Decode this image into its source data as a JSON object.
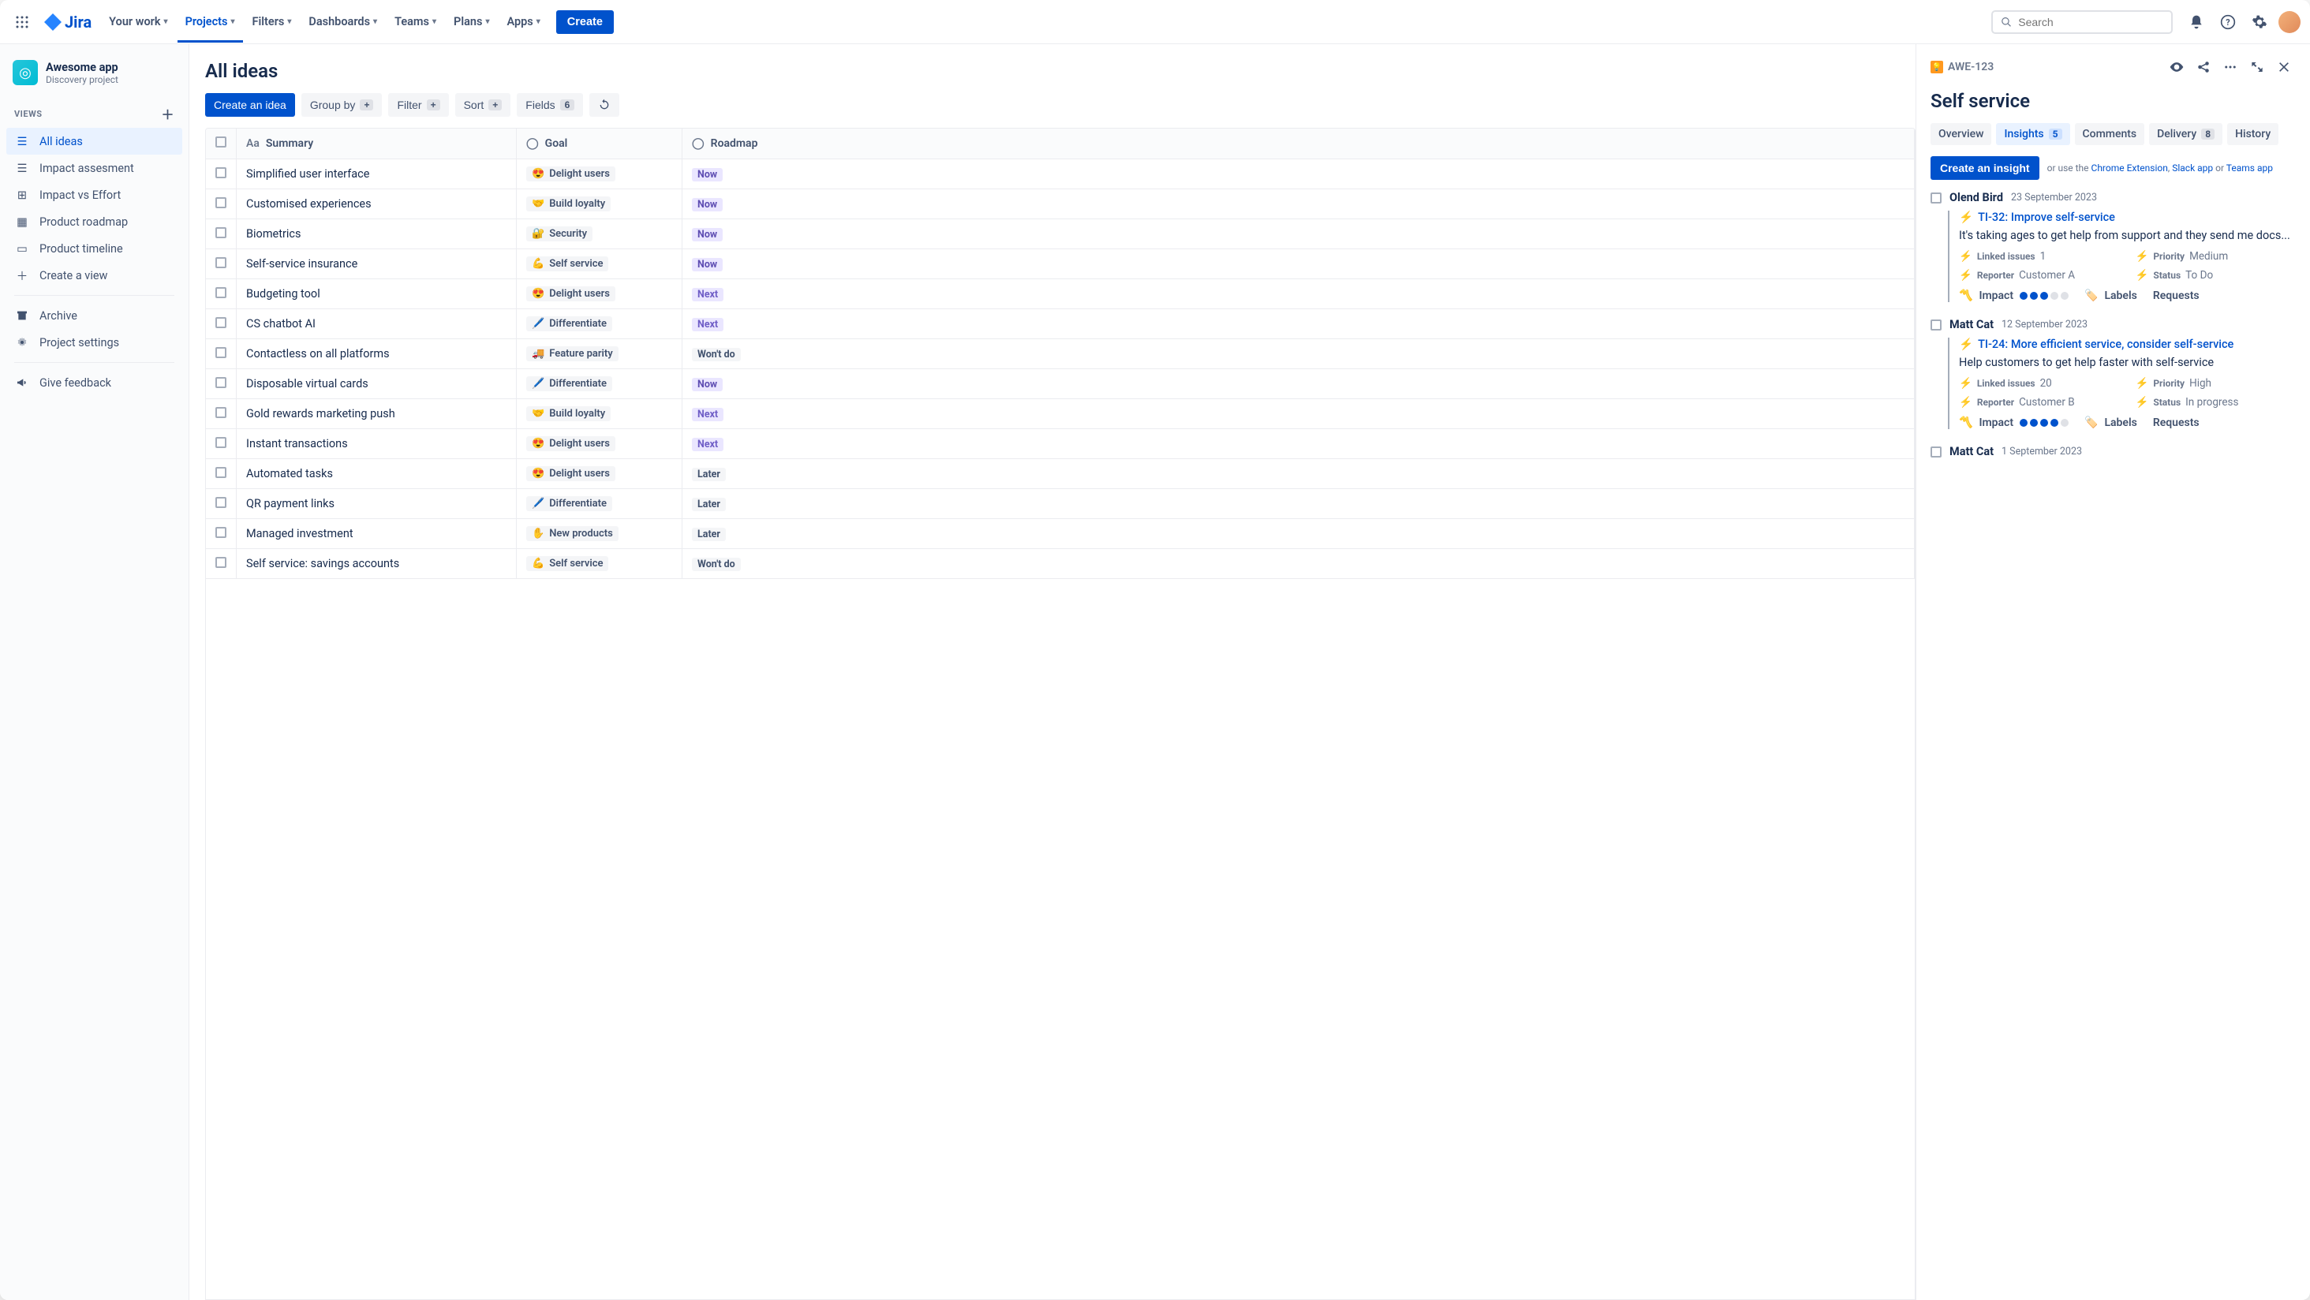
{
  "topnav": {
    "logo": "Jira",
    "items": [
      "Your work",
      "Projects",
      "Filters",
      "Dashboards",
      "Teams",
      "Plans",
      "Apps"
    ],
    "active_index": 1,
    "create": "Create",
    "search_placeholder": "Search"
  },
  "sidebar": {
    "project": {
      "name": "Awesome app",
      "type": "Discovery project"
    },
    "views_label": "Views",
    "views": [
      "All ideas",
      "Impact assesment",
      "Impact vs Effort",
      "Product roadmap",
      "Product timeline",
      "Create a view"
    ],
    "selected_view": 0,
    "archive": "Archive",
    "settings": "Project settings",
    "feedback": "Give feedback"
  },
  "page": {
    "title": "All ideas",
    "toolbar": {
      "create": "Create an idea",
      "group": "Group by",
      "filter": "Filter",
      "sort": "Sort",
      "fields": "Fields",
      "fields_count": "6"
    },
    "columns": [
      "Summary",
      "Goal",
      "Roadmap"
    ],
    "goals": {
      "delight": {
        "emoji": "😍",
        "label": "Delight users"
      },
      "loyalty": {
        "emoji": "🤝",
        "label": "Build loyalty"
      },
      "security": {
        "emoji": "🔐",
        "label": "Security"
      },
      "selfservice": {
        "emoji": "💪",
        "label": "Self service"
      },
      "differentiate": {
        "emoji": "🖊️",
        "label": "Differentiate"
      },
      "parity": {
        "emoji": "🚚",
        "label": "Feature parity"
      },
      "newproducts": {
        "emoji": "✋",
        "label": "New products"
      }
    },
    "rows": [
      {
        "summary": "Simplified user interface",
        "goal": "delight",
        "roadmap": "Now"
      },
      {
        "summary": "Customised experiences",
        "goal": "loyalty",
        "roadmap": "Now"
      },
      {
        "summary": "Biometrics",
        "goal": "security",
        "roadmap": "Now"
      },
      {
        "summary": "Self-service insurance",
        "goal": "selfservice",
        "roadmap": "Now"
      },
      {
        "summary": "Budgeting tool",
        "goal": "delight",
        "roadmap": "Next"
      },
      {
        "summary": "CS chatbot AI",
        "goal": "differentiate",
        "roadmap": "Next"
      },
      {
        "summary": "Contactless on all platforms",
        "goal": "parity",
        "roadmap": "Won't do"
      },
      {
        "summary": "Disposable virtual cards",
        "goal": "differentiate",
        "roadmap": "Now"
      },
      {
        "summary": "Gold rewards marketing push",
        "goal": "loyalty",
        "roadmap": "Next"
      },
      {
        "summary": "Instant transactions",
        "goal": "delight",
        "roadmap": "Next"
      },
      {
        "summary": "Automated tasks",
        "goal": "delight",
        "roadmap": "Later"
      },
      {
        "summary": "QR payment links",
        "goal": "differentiate",
        "roadmap": "Later"
      },
      {
        "summary": "Managed investment",
        "goal": "newproducts",
        "roadmap": "Later"
      },
      {
        "summary": "Self service: savings accounts",
        "goal": "selfservice",
        "roadmap": "Won't do"
      }
    ]
  },
  "detail": {
    "key": "AWE-123",
    "title": "Self service",
    "tabs": [
      {
        "label": "Overview"
      },
      {
        "label": "Insights",
        "count": "5",
        "active": true
      },
      {
        "label": "Comments"
      },
      {
        "label": "Delivery",
        "count": "8"
      },
      {
        "label": "History"
      }
    ],
    "create_insight": "Create an insight",
    "helper_prefix": "or use the ",
    "helper_links": [
      "Chrome Extension",
      "Slack app",
      "Teams app"
    ],
    "insights": [
      {
        "author": "Olend Bird",
        "date": "23 September 2023",
        "link": "TI-32: Improve self-service",
        "text": "It's taking ages to get help from support and they send me docs...",
        "linked_issues": "1",
        "priority": "Medium",
        "reporter": "Customer A",
        "status": "To Do",
        "impact": 3,
        "labels": "Labels",
        "requests": "Requests"
      },
      {
        "author": "Matt Cat",
        "date": "12 September 2023",
        "link": "TI-24: More efficient service, consider self-service",
        "text": "Help customers to get help faster with self-service",
        "linked_issues": "20",
        "priority": "High",
        "reporter": "Customer B",
        "status": "In progress",
        "impact": 4,
        "labels": "Labels",
        "requests": "Requests"
      },
      {
        "author": "Matt Cat",
        "date": "1 September 2023"
      }
    ],
    "meta_labels": {
      "linked": "Linked issues",
      "priority": "Priority",
      "reporter": "Reporter",
      "status": "Status",
      "impact": "Impact"
    }
  }
}
